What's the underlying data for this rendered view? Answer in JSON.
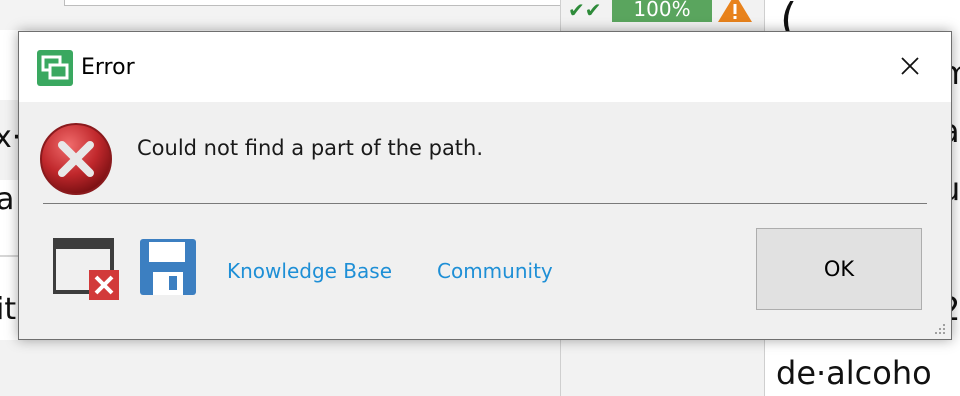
{
  "background": {
    "left_lines": [
      "x·l",
      "a",
      "it"
    ],
    "status_percent": "100%",
    "right_lines": [
      "m",
      "a",
      "u",
      "i",
      "2",
      "de·alcoho"
    ]
  },
  "dialog": {
    "title": "Error",
    "message": "Could not find a part of the path.",
    "links": {
      "knowledge_base": "Knowledge Base",
      "community": "Community"
    },
    "ok_label": "OK"
  },
  "colors": {
    "link": "#1e8fd6",
    "error_red": "#c0282c",
    "save_blue": "#3c7fc1",
    "status_green": "#5aa55e",
    "warning_orange": "#e8821c"
  }
}
